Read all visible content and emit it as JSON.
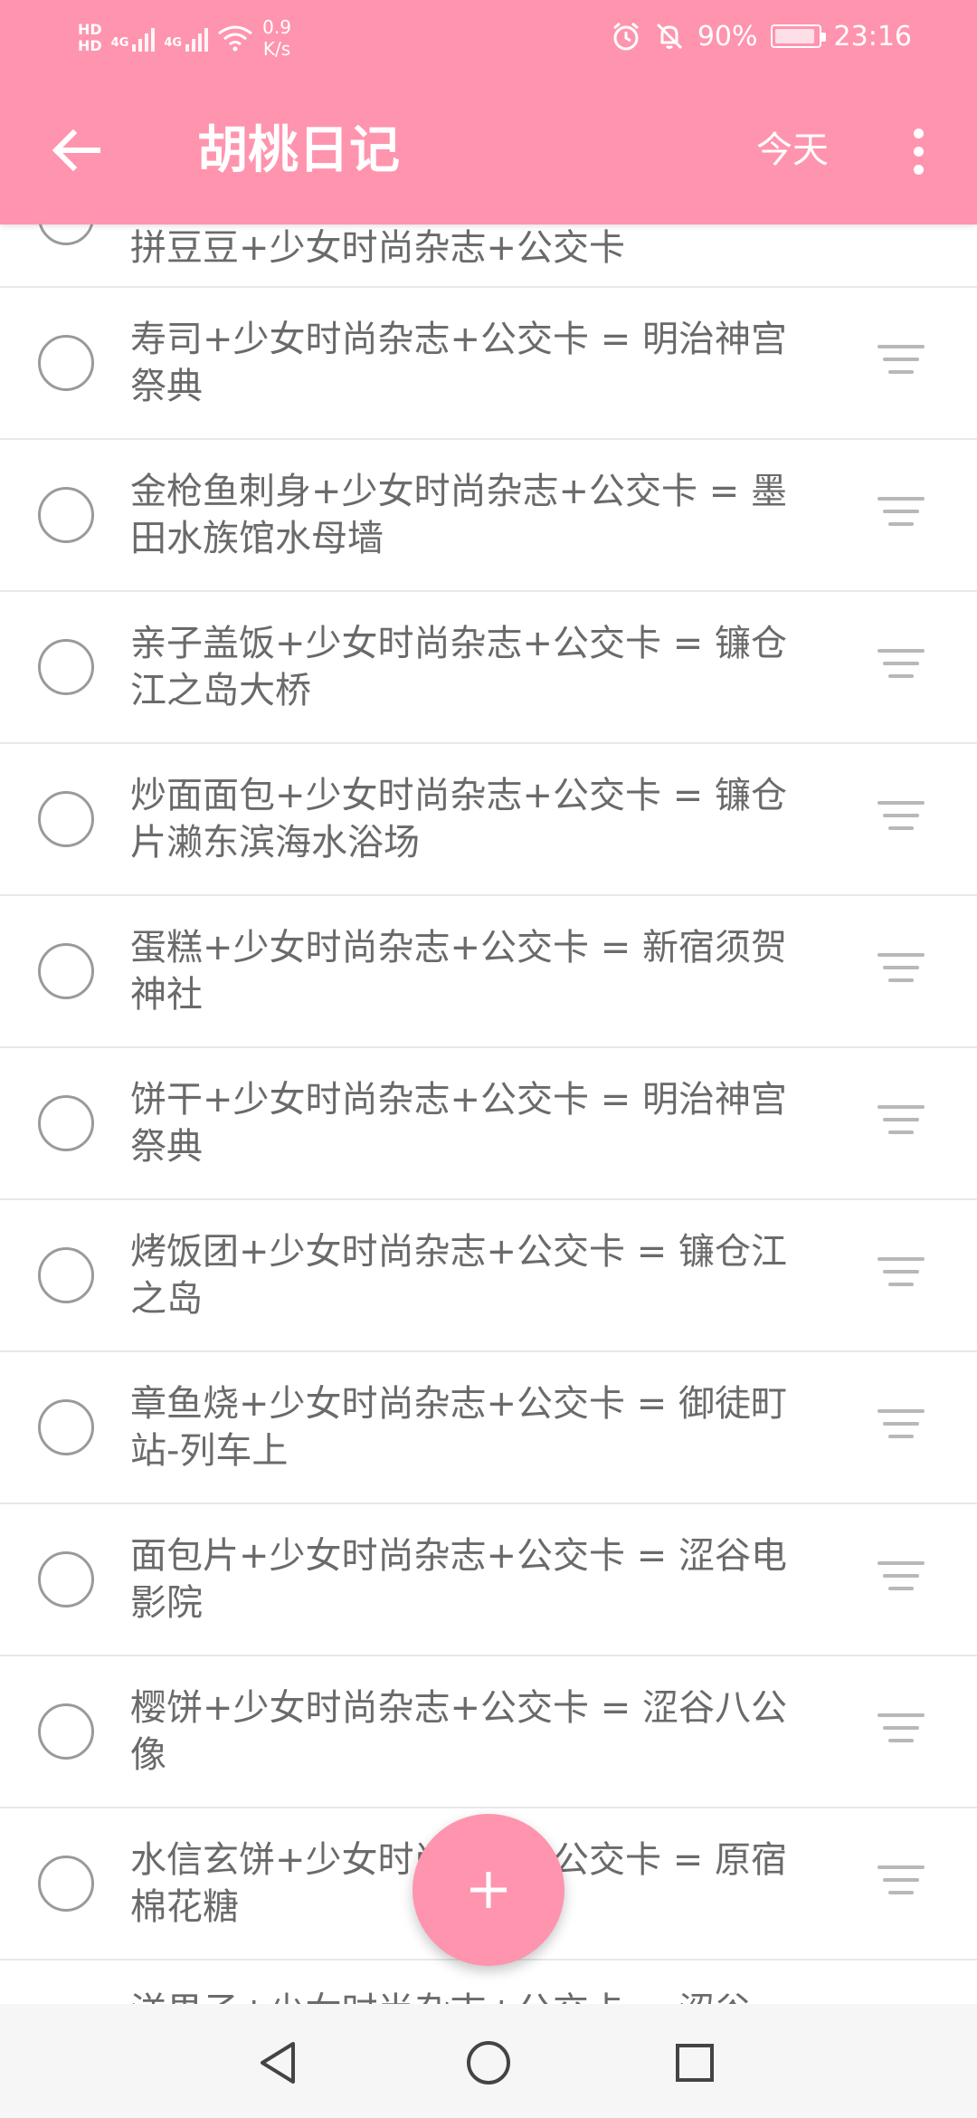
{
  "status_bar": {
    "hd1": "HD",
    "hd2": "HD",
    "net1": "4G",
    "net2": "4G",
    "speed_value": "0.9",
    "speed_unit": "K/s",
    "battery_level": 0.9,
    "battery_text": "90%",
    "time": "23:16"
  },
  "app_bar": {
    "title": "胡桃日记",
    "today_label": "今天"
  },
  "list": {
    "partial_top": "拼豆豆+少女时尚杂志+公交卡",
    "items": [
      "寿司+少女时尚杂志+公交卡 = 明治神宫祭典",
      "金枪鱼刺身+少女时尚杂志+公交卡 = 墨田水族馆水母墙",
      "亲子盖饭+少女时尚杂志+公交卡 = 镰仓江之岛大桥",
      "炒面面包+少女时尚杂志+公交卡 = 镰仓片濑东滨海水浴场",
      "蛋糕+少女时尚杂志+公交卡 = 新宿须贺神社",
      "饼干+少女时尚杂志+公交卡 = 明治神宫祭典",
      "烤饭团+少女时尚杂志+公交卡 = 镰仓江之岛",
      "章鱼烧+少女时尚杂志+公交卡 = 御徒町站-列车上",
      "面包片+少女时尚杂志+公交卡 = 涩谷电影院",
      "樱饼+少女时尚杂志+公交卡 = 涩谷八公像",
      "水信玄饼+少女时尚杂志+公交卡 = 原宿棉花糖"
    ],
    "partial_bottom": "洋果子+少女时尚杂志+公交卡 = 涩谷"
  },
  "icons": {
    "back": "back-arrow-icon",
    "more": "more-vert-icon",
    "radio": "radio-unchecked-icon",
    "handle": "drag-handle-icon",
    "fab": "add-icon",
    "nav_back": "nav-back-icon",
    "nav_home": "nav-home-icon",
    "nav_recent": "nav-recent-icon"
  },
  "colors": {
    "accent": "#ff94ae",
    "text": "#6a6a6a",
    "divider": "#e8e8e8"
  }
}
